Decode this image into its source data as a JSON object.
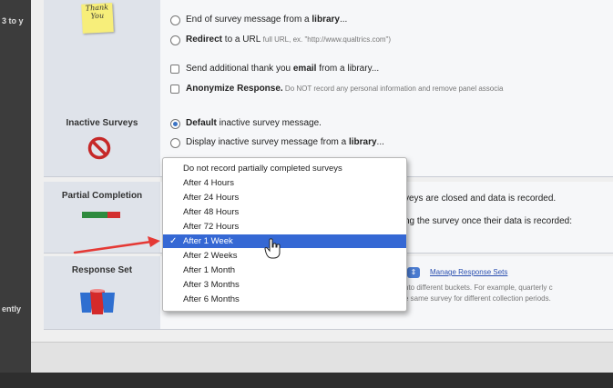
{
  "left_edge": {
    "frag_top": "3 to y",
    "frag_mid": "ently"
  },
  "thank_you": {
    "sticky_text": "Thank You",
    "opt_end_library": {
      "pre": "End of survey message from a ",
      "bold": "library",
      "post": "..."
    },
    "opt_redirect": {
      "bold": "Redirect",
      "mid": " to a URL ",
      "note": "full URL, ex. \"http://www.qualtrics.com\")"
    },
    "opt_send_email": {
      "pre": "Send additional thank you ",
      "bold": "email",
      "post": " from a library..."
    },
    "opt_anonymize": {
      "bold": "Anonymize Response.",
      "note": " Do NOT record any personal information and remove panel associa"
    }
  },
  "inactive": {
    "title": "Inactive Surveys",
    "opt_default": {
      "bold": "Default",
      "post": " inactive survey message."
    },
    "opt_library": {
      "pre": "Display inactive survey message from a ",
      "bold": "library",
      "post": "..."
    }
  },
  "partial": {
    "title": "Partial Completion",
    "text1": "veys are closed and data is recorded.",
    "text2": "ng the survey once their data is recorded:"
  },
  "response_set": {
    "title": "Response Set",
    "manage_link": "Manage Response Sets",
    "desc1": "nto different buckets. For example, quarterly c",
    "desc2": "e same survey for different collection periods."
  },
  "dropdown": {
    "options": [
      "Do not record partially completed surveys",
      "After 4 Hours",
      "After 24 Hours",
      "After 48 Hours",
      "After 72 Hours",
      "After 1 Week",
      "After 2 Weeks",
      "After 1 Month",
      "After 3 Months",
      "After 6 Months"
    ],
    "selected": "After 1 Week",
    "checkmark": "✓"
  },
  "icons": {
    "sticky": "sticky-note-icon",
    "inactive": "no-entry-icon",
    "partial": "progress-bar-icon",
    "response_set": "cups-icon",
    "arrow": "red-arrow-annotation",
    "cursor": "hand-cursor-icon"
  },
  "colors": {
    "accent": "#3568d4",
    "no_entry": "#c62828",
    "arrow": "#e53935",
    "bar_green": "#2e8b3e",
    "bar_red": "#d32f2f",
    "cup_blue": "#2f6fd0",
    "cup_red": "#d42a2a"
  }
}
